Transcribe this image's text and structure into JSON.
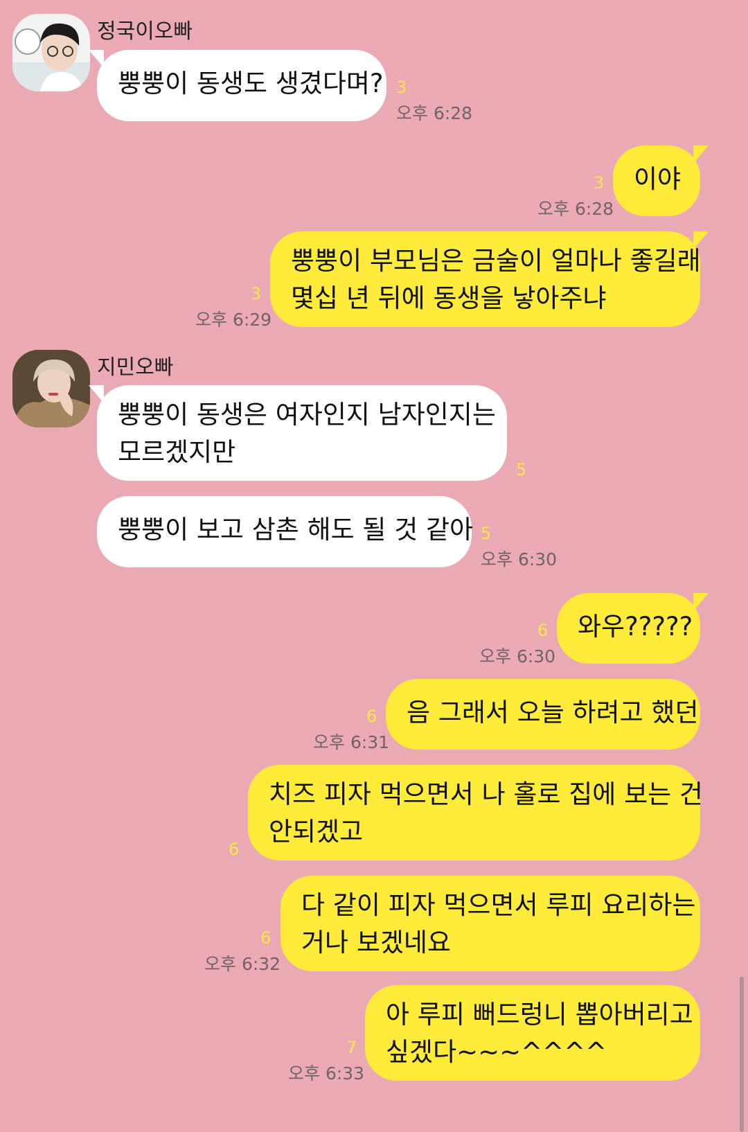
{
  "messages": [
    {
      "name": "정국이오빠",
      "avatar": "profile-photo",
      "text": "뿡뿡이 동생도 생겼다며?",
      "count": "3",
      "time": "오후 6:28"
    },
    {
      "text": "이야",
      "count": "3",
      "time": "오후 6:28"
    },
    {
      "line1": "뿡뿡이 부모님은 금술이 얼마나 좋길래",
      "line2": "몇십 년 뒤에 동생을 낳아주냐",
      "count": "3",
      "time": "오후 6:29"
    },
    {
      "name": "지민오빠",
      "avatar": "profile-photo",
      "line1": "뿡뿡이 동생은 여자인지 남자인지는",
      "line2": "모르겠지만",
      "count": "5"
    },
    {
      "text": "뿡뿡이 보고 삼촌 해도 될 것 같아",
      "count": "5",
      "time": "오후 6:30"
    },
    {
      "text": "와우?????",
      "count": "6",
      "time": "오후 6:30"
    },
    {
      "text": "음 그래서 오늘 하려고 했던",
      "count": "6",
      "time": "오후 6:31"
    },
    {
      "line1": "치즈 피자 먹으면서 나 홀로 집에 보는 건",
      "line2": "안되겠고",
      "count": "6"
    },
    {
      "line1": "다 같이 피자 먹으면서 루피 요리하는",
      "line2": "거나 보겠네요",
      "count": "6",
      "time": "오후 6:32"
    },
    {
      "line1": "아 루피 뻐드렁니 뽑아버리고",
      "line2": "싶겠다~~~^^^^",
      "count": "7",
      "time": "오후 6:33"
    }
  ],
  "colors": {
    "background": "#eaa9b3",
    "incoming_bubble": "#ffffff",
    "outgoing_bubble": "#feeb3a",
    "unread_count": "#f4e74a"
  }
}
